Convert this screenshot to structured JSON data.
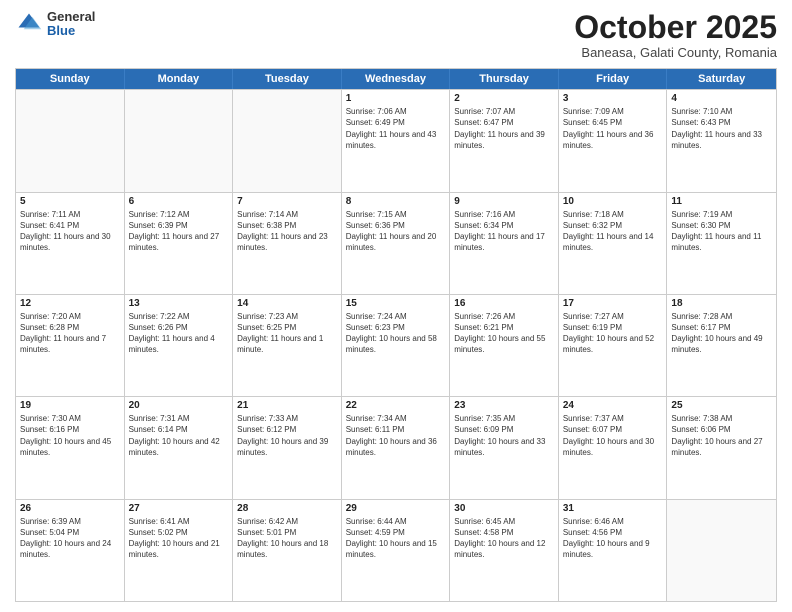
{
  "header": {
    "logo": {
      "general": "General",
      "blue": "Blue"
    },
    "title": "October 2025",
    "subtitle": "Baneasa, Galati County, Romania"
  },
  "weekdays": [
    "Sunday",
    "Monday",
    "Tuesday",
    "Wednesday",
    "Thursday",
    "Friday",
    "Saturday"
  ],
  "weeks": [
    [
      {
        "day": "",
        "sunrise": "",
        "sunset": "",
        "daylight": ""
      },
      {
        "day": "",
        "sunrise": "",
        "sunset": "",
        "daylight": ""
      },
      {
        "day": "",
        "sunrise": "",
        "sunset": "",
        "daylight": ""
      },
      {
        "day": "1",
        "sunrise": "Sunrise: 7:06 AM",
        "sunset": "Sunset: 6:49 PM",
        "daylight": "Daylight: 11 hours and 43 minutes."
      },
      {
        "day": "2",
        "sunrise": "Sunrise: 7:07 AM",
        "sunset": "Sunset: 6:47 PM",
        "daylight": "Daylight: 11 hours and 39 minutes."
      },
      {
        "day": "3",
        "sunrise": "Sunrise: 7:09 AM",
        "sunset": "Sunset: 6:45 PM",
        "daylight": "Daylight: 11 hours and 36 minutes."
      },
      {
        "day": "4",
        "sunrise": "Sunrise: 7:10 AM",
        "sunset": "Sunset: 6:43 PM",
        "daylight": "Daylight: 11 hours and 33 minutes."
      }
    ],
    [
      {
        "day": "5",
        "sunrise": "Sunrise: 7:11 AM",
        "sunset": "Sunset: 6:41 PM",
        "daylight": "Daylight: 11 hours and 30 minutes."
      },
      {
        "day": "6",
        "sunrise": "Sunrise: 7:12 AM",
        "sunset": "Sunset: 6:39 PM",
        "daylight": "Daylight: 11 hours and 27 minutes."
      },
      {
        "day": "7",
        "sunrise": "Sunrise: 7:14 AM",
        "sunset": "Sunset: 6:38 PM",
        "daylight": "Daylight: 11 hours and 23 minutes."
      },
      {
        "day": "8",
        "sunrise": "Sunrise: 7:15 AM",
        "sunset": "Sunset: 6:36 PM",
        "daylight": "Daylight: 11 hours and 20 minutes."
      },
      {
        "day": "9",
        "sunrise": "Sunrise: 7:16 AM",
        "sunset": "Sunset: 6:34 PM",
        "daylight": "Daylight: 11 hours and 17 minutes."
      },
      {
        "day": "10",
        "sunrise": "Sunrise: 7:18 AM",
        "sunset": "Sunset: 6:32 PM",
        "daylight": "Daylight: 11 hours and 14 minutes."
      },
      {
        "day": "11",
        "sunrise": "Sunrise: 7:19 AM",
        "sunset": "Sunset: 6:30 PM",
        "daylight": "Daylight: 11 hours and 11 minutes."
      }
    ],
    [
      {
        "day": "12",
        "sunrise": "Sunrise: 7:20 AM",
        "sunset": "Sunset: 6:28 PM",
        "daylight": "Daylight: 11 hours and 7 minutes."
      },
      {
        "day": "13",
        "sunrise": "Sunrise: 7:22 AM",
        "sunset": "Sunset: 6:26 PM",
        "daylight": "Daylight: 11 hours and 4 minutes."
      },
      {
        "day": "14",
        "sunrise": "Sunrise: 7:23 AM",
        "sunset": "Sunset: 6:25 PM",
        "daylight": "Daylight: 11 hours and 1 minute."
      },
      {
        "day": "15",
        "sunrise": "Sunrise: 7:24 AM",
        "sunset": "Sunset: 6:23 PM",
        "daylight": "Daylight: 10 hours and 58 minutes."
      },
      {
        "day": "16",
        "sunrise": "Sunrise: 7:26 AM",
        "sunset": "Sunset: 6:21 PM",
        "daylight": "Daylight: 10 hours and 55 minutes."
      },
      {
        "day": "17",
        "sunrise": "Sunrise: 7:27 AM",
        "sunset": "Sunset: 6:19 PM",
        "daylight": "Daylight: 10 hours and 52 minutes."
      },
      {
        "day": "18",
        "sunrise": "Sunrise: 7:28 AM",
        "sunset": "Sunset: 6:17 PM",
        "daylight": "Daylight: 10 hours and 49 minutes."
      }
    ],
    [
      {
        "day": "19",
        "sunrise": "Sunrise: 7:30 AM",
        "sunset": "Sunset: 6:16 PM",
        "daylight": "Daylight: 10 hours and 45 minutes."
      },
      {
        "day": "20",
        "sunrise": "Sunrise: 7:31 AM",
        "sunset": "Sunset: 6:14 PM",
        "daylight": "Daylight: 10 hours and 42 minutes."
      },
      {
        "day": "21",
        "sunrise": "Sunrise: 7:33 AM",
        "sunset": "Sunset: 6:12 PM",
        "daylight": "Daylight: 10 hours and 39 minutes."
      },
      {
        "day": "22",
        "sunrise": "Sunrise: 7:34 AM",
        "sunset": "Sunset: 6:11 PM",
        "daylight": "Daylight: 10 hours and 36 minutes."
      },
      {
        "day": "23",
        "sunrise": "Sunrise: 7:35 AM",
        "sunset": "Sunset: 6:09 PM",
        "daylight": "Daylight: 10 hours and 33 minutes."
      },
      {
        "day": "24",
        "sunrise": "Sunrise: 7:37 AM",
        "sunset": "Sunset: 6:07 PM",
        "daylight": "Daylight: 10 hours and 30 minutes."
      },
      {
        "day": "25",
        "sunrise": "Sunrise: 7:38 AM",
        "sunset": "Sunset: 6:06 PM",
        "daylight": "Daylight: 10 hours and 27 minutes."
      }
    ],
    [
      {
        "day": "26",
        "sunrise": "Sunrise: 6:39 AM",
        "sunset": "Sunset: 5:04 PM",
        "daylight": "Daylight: 10 hours and 24 minutes."
      },
      {
        "day": "27",
        "sunrise": "Sunrise: 6:41 AM",
        "sunset": "Sunset: 5:02 PM",
        "daylight": "Daylight: 10 hours and 21 minutes."
      },
      {
        "day": "28",
        "sunrise": "Sunrise: 6:42 AM",
        "sunset": "Sunset: 5:01 PM",
        "daylight": "Daylight: 10 hours and 18 minutes."
      },
      {
        "day": "29",
        "sunrise": "Sunrise: 6:44 AM",
        "sunset": "Sunset: 4:59 PM",
        "daylight": "Daylight: 10 hours and 15 minutes."
      },
      {
        "day": "30",
        "sunrise": "Sunrise: 6:45 AM",
        "sunset": "Sunset: 4:58 PM",
        "daylight": "Daylight: 10 hours and 12 minutes."
      },
      {
        "day": "31",
        "sunrise": "Sunrise: 6:46 AM",
        "sunset": "Sunset: 4:56 PM",
        "daylight": "Daylight: 10 hours and 9 minutes."
      },
      {
        "day": "",
        "sunrise": "",
        "sunset": "",
        "daylight": ""
      }
    ]
  ]
}
